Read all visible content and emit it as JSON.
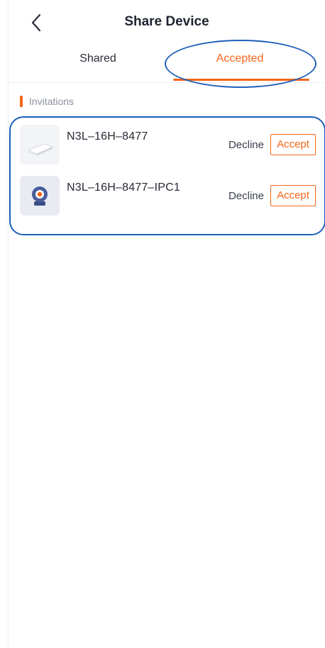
{
  "header": {
    "title": "Share Device",
    "back_icon": "chevron-left-icon"
  },
  "tabs": [
    {
      "label": "Shared",
      "active": false
    },
    {
      "label": "Accepted",
      "active": true
    }
  ],
  "section": {
    "label": "Invitations"
  },
  "invitations": [
    {
      "name": "N3L–16H–8477",
      "icon": "nvr-device-icon",
      "decline_label": "Decline",
      "accept_label": "Accept"
    },
    {
      "name": "N3L–16H–8477–IPC1",
      "icon": "camera-device-icon",
      "decline_label": "Decline",
      "accept_label": "Accept"
    }
  ],
  "colors": {
    "accent": "#f4661b",
    "annotation": "#1f5fb8",
    "text_primary": "#222633",
    "text_secondary": "#8b909c"
  }
}
